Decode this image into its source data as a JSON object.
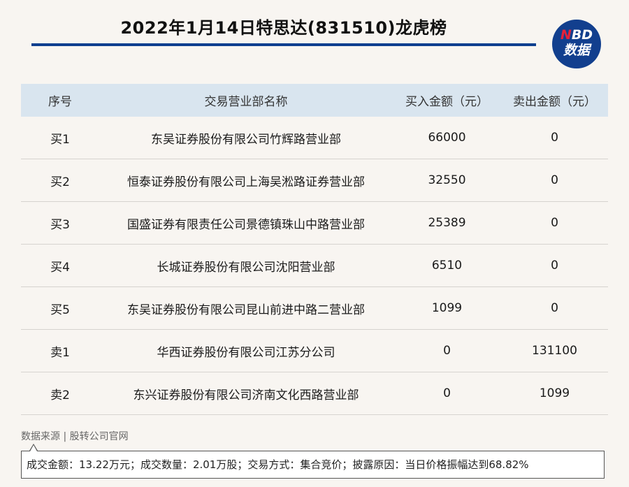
{
  "title": "2022年1月14日特思达(831510)龙虎榜",
  "logo": {
    "line1_n": "N",
    "line1_rest": "BD",
    "line2": "数据"
  },
  "table": {
    "headers": [
      "序号",
      "交易营业部名称",
      "买入金额（元）",
      "卖出金额（元）"
    ],
    "rows": [
      [
        "买1",
        "东吴证券股份有限公司竹辉路营业部",
        "66000",
        "0"
      ],
      [
        "买2",
        "恒泰证券股份有限公司上海吴淞路证券营业部",
        "32550",
        "0"
      ],
      [
        "买3",
        "国盛证券有限责任公司景德镇珠山中路营业部",
        "25389",
        "0"
      ],
      [
        "买4",
        "长城证券股份有限公司沈阳营业部",
        "6510",
        "0"
      ],
      [
        "买5",
        "东吴证券股份有限公司昆山前进中路二营业部",
        "1099",
        "0"
      ],
      [
        "卖1",
        "华西证券股份有限公司江苏分公司",
        "0",
        "131100"
      ],
      [
        "卖2",
        "东兴证券股份有限公司济南文化西路营业部",
        "0",
        "1099"
      ]
    ]
  },
  "source": "数据来源 | 股转公司官网",
  "note": "成交金额：13.22万元；成交数量：2.01万股；交易方式：集合竞价；披露原因：当日价格振幅达到68.82%",
  "colors": {
    "accent": "#0e3f8f",
    "header_bg": "#d9e5ef",
    "logo_red": "#e5213a",
    "page_bg": "#f8f5f1"
  }
}
